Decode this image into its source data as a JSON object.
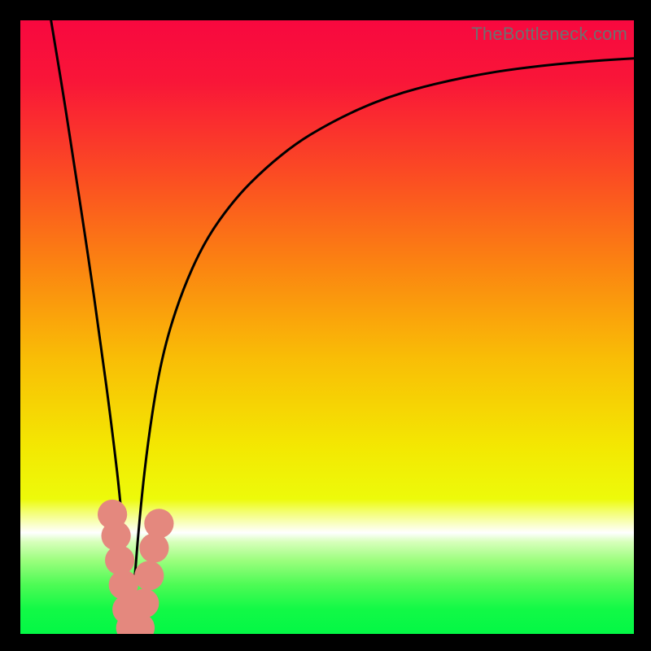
{
  "watermark": {
    "text": "TheBottleneck.com"
  },
  "chart_data": {
    "type": "line",
    "title": "",
    "xlabel": "",
    "ylabel": "",
    "xlim": [
      0,
      100
    ],
    "ylim": [
      0,
      100
    ],
    "grid": false,
    "legend": false,
    "notch_x": 18,
    "series": [
      {
        "name": "bottleneck-curve",
        "color": "#000000",
        "x": [
          5,
          7,
          9,
          11,
          13,
          15,
          16.5,
          18,
          19.5,
          21,
          23,
          26,
          30,
          35,
          40,
          45,
          50,
          55,
          60,
          65,
          70,
          75,
          80,
          85,
          90,
          95,
          100
        ],
        "values": [
          100,
          88,
          75,
          62,
          48,
          33,
          20,
          1,
          20,
          33,
          45,
          55,
          64,
          71,
          76,
          80,
          83,
          85.5,
          87.5,
          89,
          90.2,
          91.2,
          92,
          92.6,
          93.1,
          93.5,
          93.8
        ]
      }
    ],
    "markers": {
      "name": "highlight-dots",
      "color": "#E4887E",
      "points": [
        {
          "x": 15.0,
          "y": 19.5,
          "r": 2.4
        },
        {
          "x": 15.6,
          "y": 16.0,
          "r": 2.4
        },
        {
          "x": 16.2,
          "y": 12.0,
          "r": 2.4
        },
        {
          "x": 16.8,
          "y": 8.0,
          "r": 2.4
        },
        {
          "x": 17.4,
          "y": 4.0,
          "r": 2.4
        },
        {
          "x": 18.0,
          "y": 1.0,
          "r": 2.4
        },
        {
          "x": 19.5,
          "y": 1.0,
          "r": 2.4
        },
        {
          "x": 20.2,
          "y": 5.0,
          "r": 2.4
        },
        {
          "x": 21.0,
          "y": 9.5,
          "r": 2.4
        },
        {
          "x": 21.8,
          "y": 14.0,
          "r": 2.4
        },
        {
          "x": 22.6,
          "y": 18.0,
          "r": 2.4
        }
      ]
    },
    "gradient_stops": [
      {
        "pos": 0.0,
        "color": "#F8083F"
      },
      {
        "pos": 0.1,
        "color": "#F91638"
      },
      {
        "pos": 0.25,
        "color": "#FB4B23"
      },
      {
        "pos": 0.4,
        "color": "#FB8411"
      },
      {
        "pos": 0.55,
        "color": "#F9BD06"
      },
      {
        "pos": 0.7,
        "color": "#F3E902"
      },
      {
        "pos": 0.78,
        "color": "#EDFA0A"
      },
      {
        "pos": 0.8,
        "color": "#F3FE6B"
      },
      {
        "pos": 0.82,
        "color": "#F9FFC1"
      },
      {
        "pos": 0.835,
        "color": "#FFFFFF"
      },
      {
        "pos": 0.85,
        "color": "#D7FFBB"
      },
      {
        "pos": 0.88,
        "color": "#9CFE7E"
      },
      {
        "pos": 0.92,
        "color": "#4DFB55"
      },
      {
        "pos": 0.96,
        "color": "#12F946"
      },
      {
        "pos": 1.0,
        "color": "#03F845"
      }
    ]
  }
}
